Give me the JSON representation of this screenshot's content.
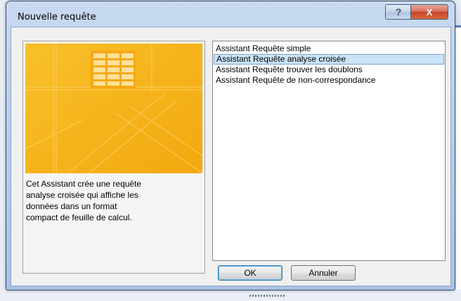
{
  "dialog": {
    "title": "Nouvelle requête",
    "help_glyph": "?",
    "close_glyph": "X"
  },
  "description": {
    "lines": [
      "Cet Assistant crée une requête",
      "analyse croisée qui affiche les",
      "données dans un format",
      "compact de feuille de calcul."
    ]
  },
  "list": {
    "items": [
      "Assistant Requête simple",
      "Assistant Requête analyse croisée",
      "Assistant Requête trouver les doublons",
      "Assistant Requête de non-correspondance"
    ],
    "selected_index": 1
  },
  "buttons": {
    "ok_label": "OK",
    "cancel_label": "Annuler"
  },
  "colors": {
    "preview_orange": "#f6b51b",
    "selection": "#cce4f7"
  }
}
